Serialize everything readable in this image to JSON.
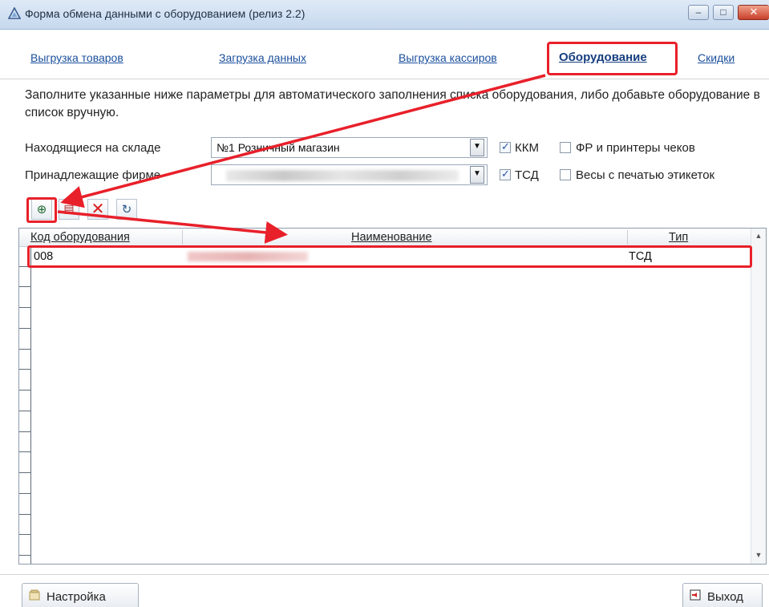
{
  "window": {
    "title": "Форма обмена данными с оборудованием (релиз 2.2)",
    "controls": {
      "minimize": "–",
      "maximize": "□",
      "close": "✕"
    }
  },
  "tabs": [
    {
      "label": "Выгрузка товаров"
    },
    {
      "label": "Загрузка данных"
    },
    {
      "label": "Выгрузка кассиров"
    },
    {
      "label": "Оборудование",
      "active": true
    },
    {
      "label": "Скидки"
    }
  ],
  "description": "Заполните указанные ниже параметры для автоматического заполнения списка оборудования, либо добавьте оборудование в список вручную.",
  "filters": {
    "warehouse_label": "Находящиеся на складе",
    "warehouse_value": "№1 Розничный магазин",
    "company_label": "Принадлежащие фирме",
    "company_value": "",
    "kkm_label": "ККМ",
    "kkm_checked": true,
    "fr_label": "ФР и принтеры чеков",
    "fr_checked": false,
    "tsd_label": "ТСД",
    "tsd_checked": true,
    "scales_label": "Весы с печатью этикеток",
    "scales_checked": false
  },
  "toolbar": {
    "add_icon": "add-icon",
    "edit_icon": "edit-icon",
    "delete_icon": "delete-icon",
    "refresh_icon": "refresh-icon"
  },
  "grid": {
    "columns": [
      "Код оборудования",
      "Наименование",
      "Тип"
    ],
    "rows": [
      {
        "code": "008",
        "name": "",
        "type": "ТСД"
      }
    ]
  },
  "footer": {
    "setup_label": "Настройка",
    "exit_label": "Выход"
  },
  "colors": {
    "highlight": "#e8202a",
    "link": "#1b4f9c"
  }
}
